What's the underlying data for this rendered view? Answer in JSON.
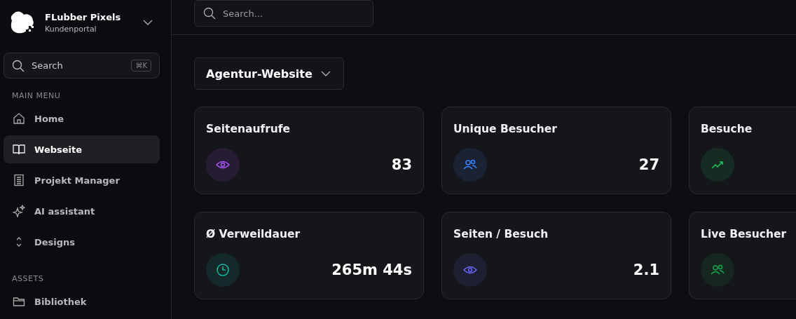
{
  "brand": {
    "name": "FLubber Pixels",
    "subtitle": "Kundenportal"
  },
  "sidebar_search": {
    "placeholder": "Search",
    "shortcut": "⌘K"
  },
  "sections": [
    {
      "title": "MAIN MENU",
      "items": [
        {
          "label": "Home",
          "kind": "home",
          "selected": false
        },
        {
          "label": "Webseite",
          "kind": "book",
          "selected": true
        },
        {
          "label": "Projekt Manager",
          "kind": "list",
          "selected": false
        },
        {
          "label": "AI assistant",
          "kind": "sparkle",
          "selected": false
        },
        {
          "label": "Designs",
          "kind": "chevrons",
          "selected": false
        }
      ]
    },
    {
      "title": "ASSETS",
      "items": [
        {
          "label": "Bibliothek",
          "kind": "folder",
          "selected": false
        }
      ]
    }
  ],
  "search": {
    "placeholder": "Search..."
  },
  "site_select": {
    "value": "Agentur-Website"
  },
  "cards": [
    {
      "title": "Seitenaufrufe",
      "kind": "eye",
      "color": "#a855f7",
      "value": "83"
    },
    {
      "title": "Unique Besucher",
      "kind": "users",
      "color": "#3b82f6",
      "value": "27"
    },
    {
      "title": "Besuche",
      "kind": "trend",
      "color": "#22c55e"
    },
    {
      "title": "Ø Verweildauer",
      "kind": "clock",
      "color": "#14b8a6",
      "value": "265m 44s"
    },
    {
      "title": "Seiten / Besuch",
      "kind": "eye",
      "color": "#6366f1",
      "value": "2.1"
    },
    {
      "title": "Live Besucher",
      "kind": "users",
      "color": "#16a34a"
    }
  ]
}
